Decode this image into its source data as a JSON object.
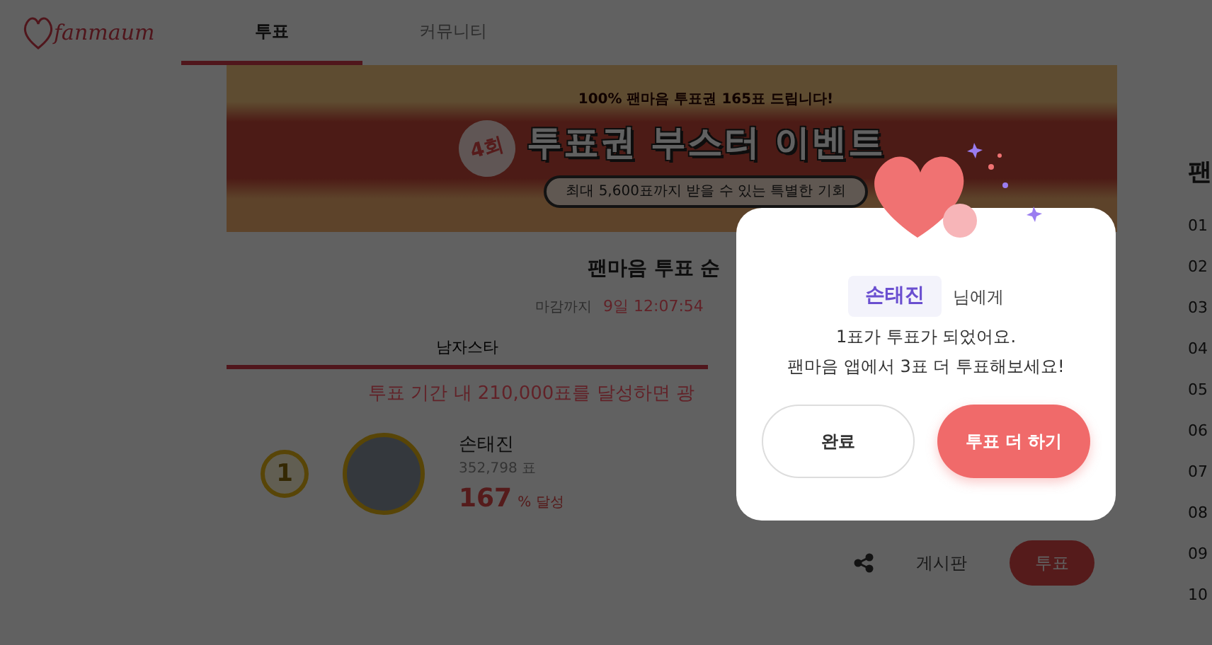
{
  "header": {
    "logo": "fanmaum",
    "tabs": [
      {
        "label": "투표",
        "selected": true
      },
      {
        "label": "커뮤니티",
        "selected": false
      }
    ]
  },
  "banner": {
    "round_badge": "4회",
    "tagline": "100% 팬마음 투표권 165표 드립니다!",
    "headline": "투표권 부스터 이벤트",
    "subline": "최대 5,600표까지 받을 수 있는 특별한 기회"
  },
  "vote": {
    "title": "팬마음 투표 순",
    "deadline_label": "마감까지",
    "countdown": "9일 12:07:54",
    "categories": [
      {
        "label": "남자스타",
        "selected": true
      }
    ],
    "goal": "투표 기간 내 210,000표를 달성하면 광",
    "ranking": [
      {
        "rank": "1",
        "name": "손태진",
        "votes": "352,798 표",
        "percent": "167",
        "percent_suffix": "% 달성"
      }
    ],
    "actions": {
      "board": "게시판",
      "vote": "투표"
    }
  },
  "sidebar": {
    "title": "팬",
    "ranks": [
      "01",
      "02",
      "03",
      "04",
      "05",
      "06",
      "07",
      "08",
      "09",
      "10"
    ]
  },
  "dialog": {
    "name": "손태진",
    "suffix": "님에게",
    "message": [
      "1표가 투표가 되었어요.",
      "팬마음 앱에서 3표 더 투표해보세요!"
    ],
    "buttons": [
      {
        "label": "완료",
        "kind": "secondary"
      },
      {
        "label": "투표 더 하기",
        "kind": "primary"
      }
    ]
  }
}
